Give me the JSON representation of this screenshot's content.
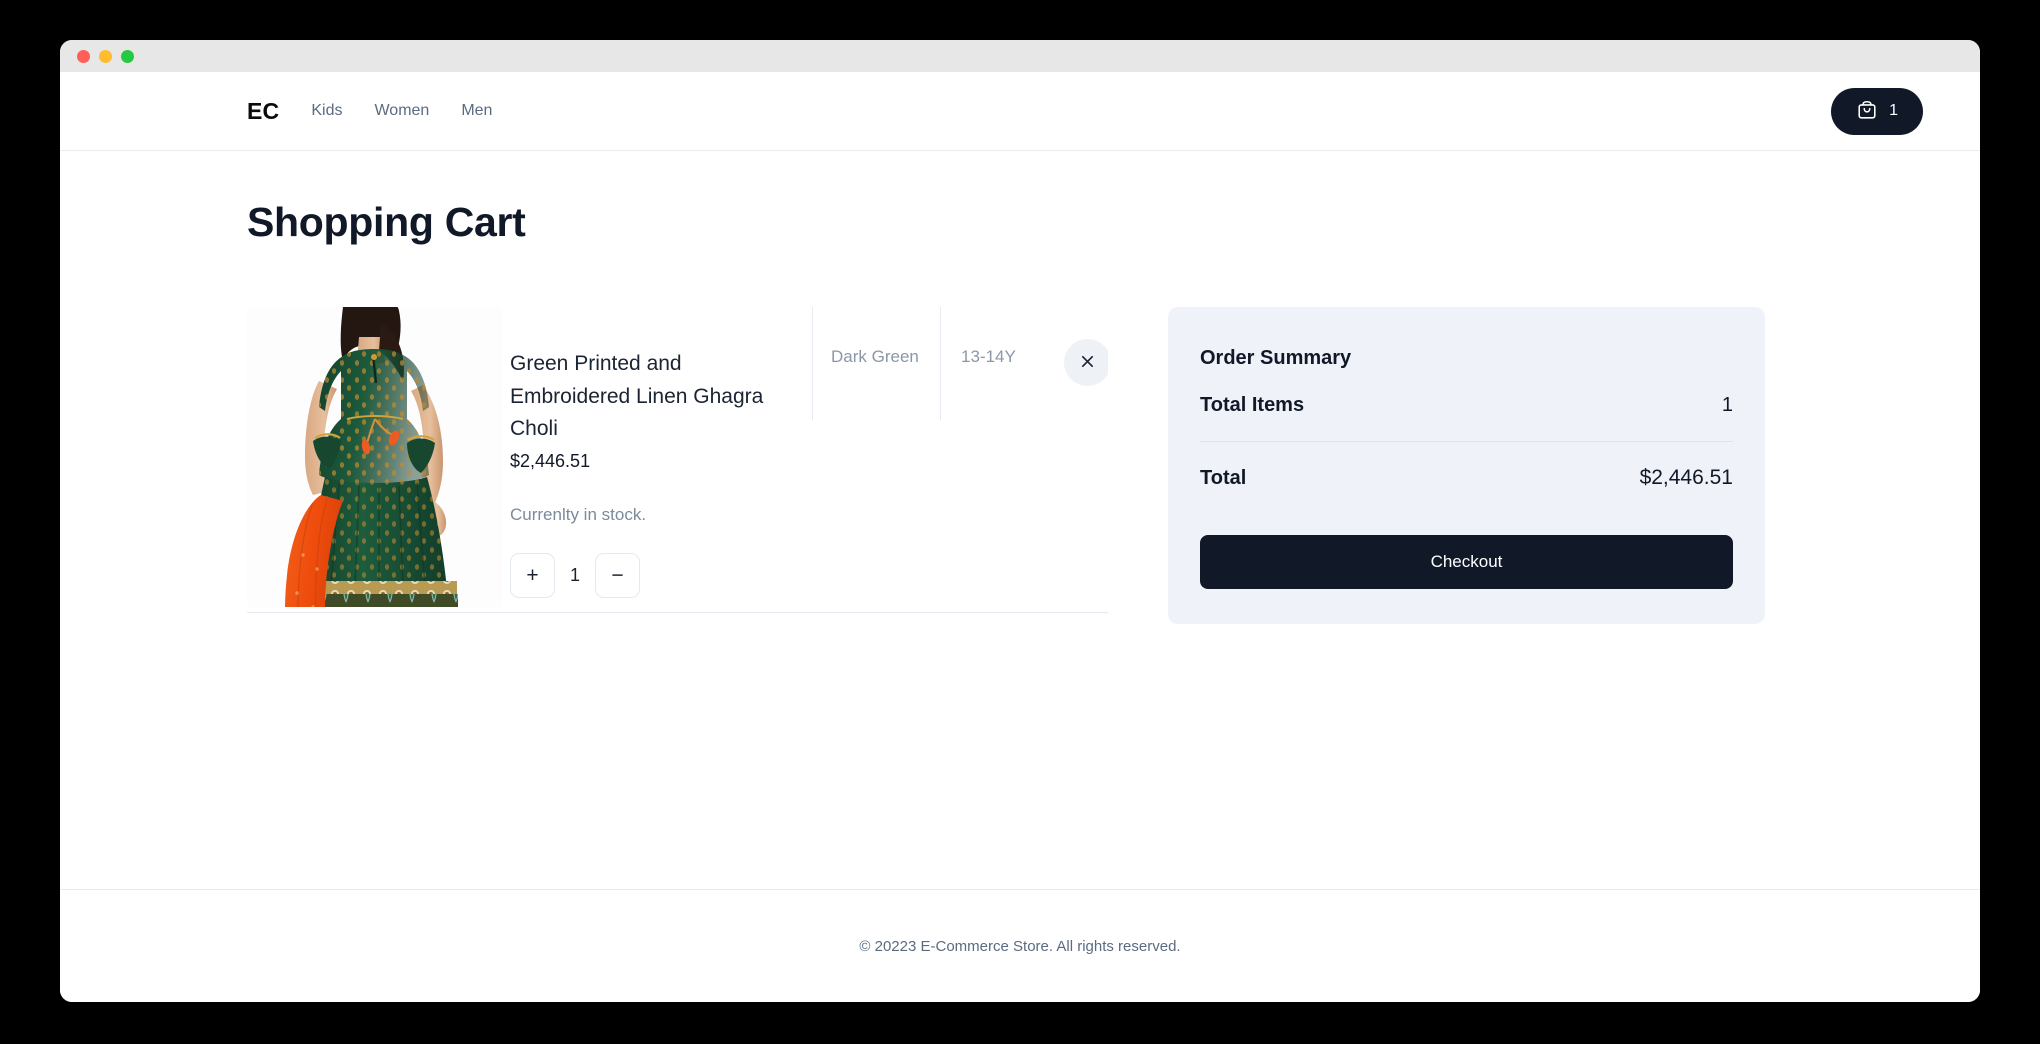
{
  "window": {
    "traffic_lights": [
      "close",
      "minimize",
      "zoom"
    ]
  },
  "header": {
    "brand": "EC",
    "nav": [
      {
        "label": "Kids"
      },
      {
        "label": "Women"
      },
      {
        "label": "Men"
      }
    ],
    "cart": {
      "icon": "shopping-bag-icon",
      "count": "1"
    }
  },
  "main": {
    "page_title": "Shopping Cart",
    "cart_items": [
      {
        "image_alt": "Green Printed and Embroidered Linen Ghagra Choli",
        "title": "Green Printed and Embroidered Linen Ghagra Choli",
        "price": "$2,446.51",
        "stock_status": "Currenlty in stock.",
        "quantity": "1",
        "increase_label": "+",
        "decrease_label": "−",
        "color": "Dark Green",
        "size": "13-14Y",
        "remove_label": "×"
      }
    ]
  },
  "order_summary": {
    "title": "Order Summary",
    "rows": [
      {
        "label": "Total Items",
        "value": "1"
      },
      {
        "label": "Total",
        "value": "$2,446.51"
      }
    ],
    "checkout_label": "Checkout"
  },
  "footer": {
    "text": "© 20223 E-Commerce Store. All rights reserved."
  },
  "colors": {
    "brand_dark": "#111827",
    "summary_bg": "#eff3f9",
    "muted_text": "#7c8a9c",
    "border": "#e4e9f0",
    "accent_green": "#1c5038",
    "accent_orange": "#ef5414"
  }
}
